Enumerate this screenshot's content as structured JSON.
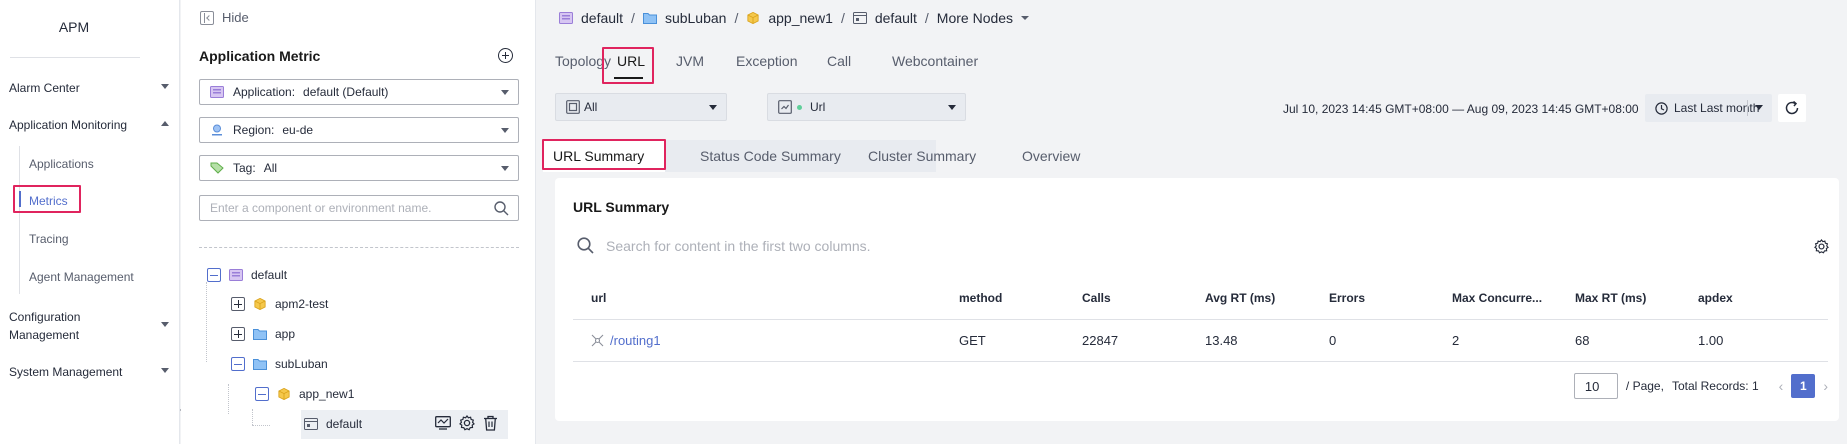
{
  "nav": {
    "title": "APM",
    "groups": {
      "alarm_center": "Alarm Center",
      "app_monitoring": "Application Monitoring",
      "config_mgmt_line1": "Configuration",
      "config_mgmt_line2": "Management",
      "system_mgmt": "System Management"
    },
    "subitems": {
      "applications": "Applications",
      "metrics": "Metrics",
      "tracing": "Tracing",
      "agent_management": "Agent Management"
    }
  },
  "tree_panel": {
    "hide_label": "Hide",
    "title": "Application Metric",
    "application": {
      "label": "Application:",
      "value": "default (Default)"
    },
    "region": {
      "label": "Region:",
      "value": "eu-de"
    },
    "tag": {
      "label": "Tag:",
      "value": "All"
    },
    "search_placeholder": "Enter a component or environment name.",
    "nodes": {
      "default": "default",
      "apm2_test": "apm2-test",
      "app": "app",
      "subluban": "subLuban",
      "app_new1": "app_new1",
      "env_default": "default"
    }
  },
  "breadcrumb": {
    "items": [
      "default",
      "subLuban",
      "app_new1",
      "default"
    ],
    "more": "More Nodes",
    "separator": "/"
  },
  "tabs": [
    "Topology",
    "URL",
    "JVM",
    "Exception",
    "Call",
    "Webcontainer"
  ],
  "filters": {
    "scope": "All",
    "type": "Url",
    "time_range": "Jul 10, 2023 14:45 GMT+08:00 — Aug 09, 2023 14:45 GMT+08:00",
    "period": "Last Last month"
  },
  "subtabs": [
    "URL Summary",
    "Status Code Summary",
    "Cluster Summary",
    "Overview"
  ],
  "card": {
    "title": "URL Summary",
    "search_placeholder": "Search for content in the first two columns.",
    "columns": [
      "url",
      "method",
      "Calls",
      "Avg RT (ms)",
      "Errors",
      "Max Concurre...",
      "Max RT (ms)",
      "apdex"
    ],
    "rows": [
      {
        "url": "/routing1",
        "method": "GET",
        "calls": "22847",
        "avg_rt": "13.48",
        "errors": "0",
        "max_concurrency": "2",
        "max_rt": "68",
        "apdex": "1.00"
      }
    ]
  },
  "pagination": {
    "page_size": "10",
    "per_page": "/ Page,",
    "total": "Total Records: 1",
    "current_page": "1"
  },
  "colors": {
    "accent": "#526ecc",
    "highlight": "#e0245e"
  }
}
